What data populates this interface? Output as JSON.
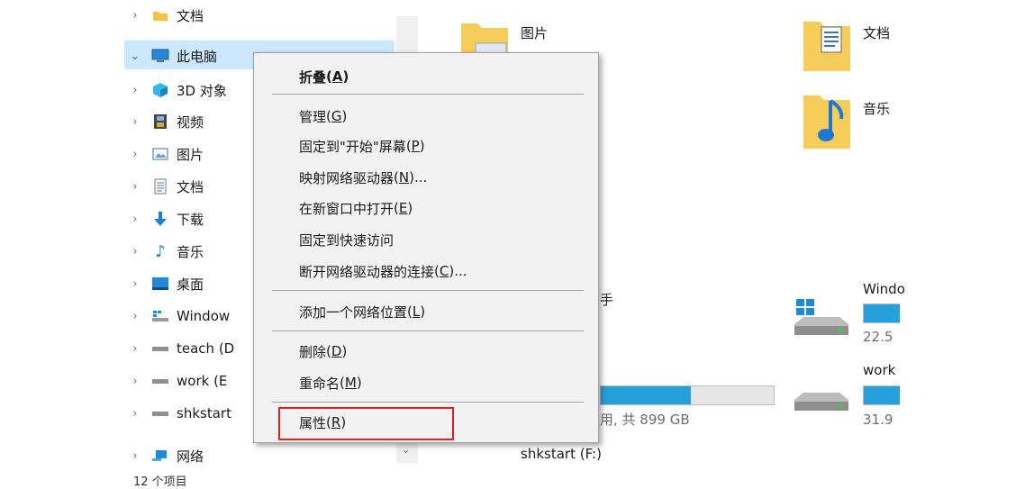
{
  "nav": {
    "items": [
      {
        "label": "文档"
      },
      {
        "label": "此电脑"
      },
      {
        "label": "3D 对象"
      },
      {
        "label": "视频"
      },
      {
        "label": "图片"
      },
      {
        "label": "文档"
      },
      {
        "label": "下载"
      },
      {
        "label": "音乐"
      },
      {
        "label": "桌面"
      },
      {
        "label": "Window"
      },
      {
        "label": "teach (D"
      },
      {
        "label": "work (E"
      },
      {
        "label": "shkstart"
      },
      {
        "label": "网络"
      }
    ],
    "status_partial": "12 个项目"
  },
  "content": {
    "folders": [
      {
        "label": "图片"
      },
      {
        "label": "文档"
      },
      {
        "label": "音乐"
      }
    ],
    "partial_text_1": "手",
    "drive_usage_text": "用, 共 899 GB",
    "drive_shkstart_label": "shkstart (F:)",
    "drives_right": [
      {
        "label": "Windo",
        "size": "22.5",
        "fill": 0.5
      },
      {
        "label": "work",
        "size": "31.9",
        "fill": 0.5
      }
    ],
    "drive_mid_fill": 0.52
  },
  "menu": {
    "items": {
      "collapse": {
        "text": "折叠",
        "key": "A"
      },
      "manage": {
        "text": "管理",
        "key": "G"
      },
      "pin_start": {
        "text": "固定到\"开始\"屏幕",
        "key": "P"
      },
      "map_drive": {
        "text": "映射网络驱动器",
        "key": "N",
        "suffix": "..."
      },
      "open_new_window": {
        "text": "在新窗口中打开",
        "key": "E"
      },
      "pin_quick": {
        "text": "固定到快速访问"
      },
      "disconnect": {
        "text": "断开网络驱动器的连接",
        "key": "C",
        "suffix": "..."
      },
      "add_network": {
        "text": "添加一个网络位置",
        "key": "L"
      },
      "delete": {
        "text": "删除",
        "key": "D"
      },
      "rename": {
        "text": "重命名",
        "key": "M"
      },
      "properties": {
        "text": "属性",
        "key": "R"
      }
    }
  },
  "colors": {
    "selection": "#cce8ff",
    "bar_fill": "#26a0da",
    "highlight": "#e02020"
  }
}
